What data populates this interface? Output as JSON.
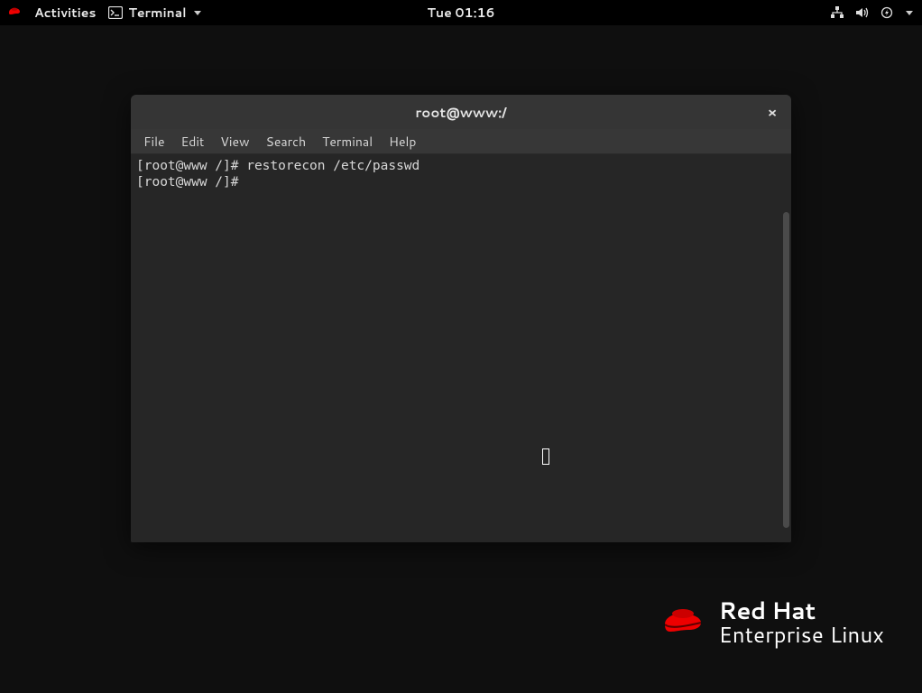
{
  "topbar": {
    "activities": "Activities",
    "app_name": "Terminal",
    "clock": "Tue 01:16"
  },
  "window": {
    "title": "root@www:/",
    "close_glyph": "×"
  },
  "menubar": {
    "file": "File",
    "edit": "Edit",
    "view": "View",
    "search": "Search",
    "terminal": "Terminal",
    "help": "Help"
  },
  "terminal": {
    "lines": [
      "[root@www /]# restorecon /etc/passwd",
      "[root@www /]# "
    ]
  },
  "branding": {
    "line1": "Red Hat",
    "line2": "Enterprise Linux"
  }
}
